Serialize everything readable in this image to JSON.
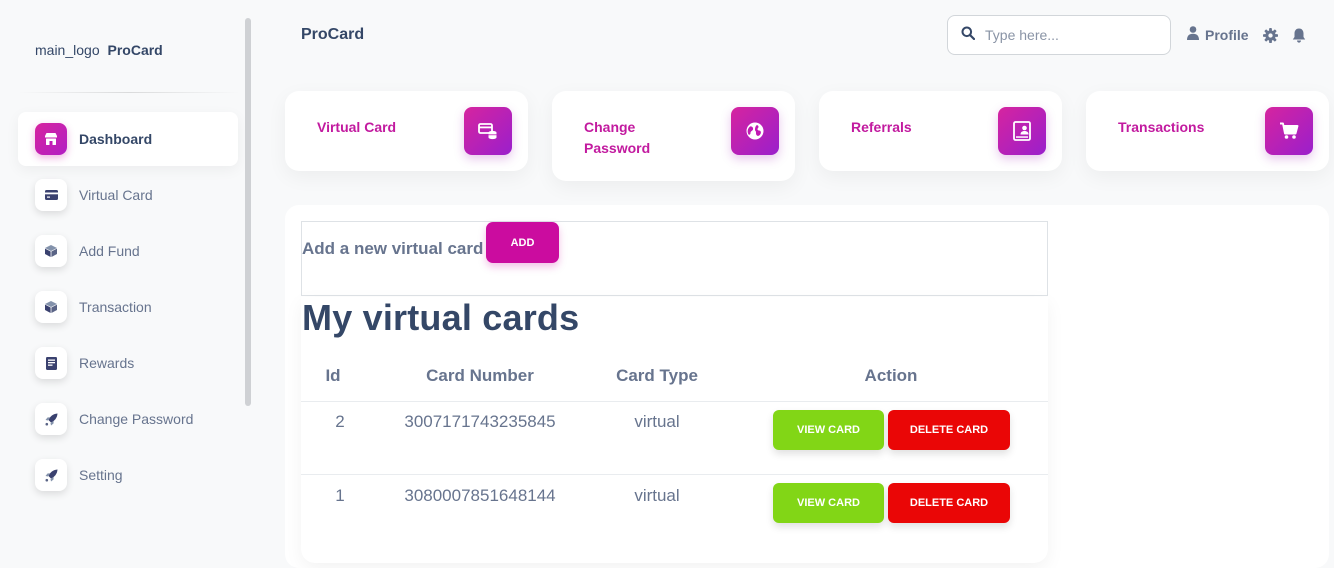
{
  "sidebar": {
    "logo_alt": "main_logo",
    "brand_name": "ProCard",
    "items": [
      {
        "label": "Dashboard",
        "icon": "shop-icon",
        "active": true
      },
      {
        "label": "Virtual Card",
        "icon": "credit-card-icon"
      },
      {
        "label": "Add Fund",
        "icon": "box-icon"
      },
      {
        "label": "Transaction",
        "icon": "box-icon"
      },
      {
        "label": "Rewards",
        "icon": "document-icon"
      },
      {
        "label": "Change Password",
        "icon": "rocket-icon"
      },
      {
        "label": "Setting",
        "icon": "rocket-icon"
      }
    ]
  },
  "header": {
    "title": "ProCard",
    "search_placeholder": "Type here...",
    "profile_label": "Profile"
  },
  "stat_cards": [
    {
      "label": "Virtual Card",
      "icon": "credit-card-icon"
    },
    {
      "label": "Change Password",
      "icon": "globe-icon"
    },
    {
      "label": "Referrals",
      "icon": "badge-icon"
    },
    {
      "label": "Transactions",
      "icon": "cart-icon"
    }
  ],
  "add_card": {
    "label": "Add a new virtual card",
    "button": "ADD"
  },
  "cards_table": {
    "title": "My virtual cards",
    "headers": [
      "Id",
      "Card Number",
      "Card Type",
      "Action"
    ],
    "rows": [
      {
        "id": "2",
        "number": "3007171743235845",
        "type": "virtual"
      },
      {
        "id": "1",
        "number": "3080007851648144",
        "type": "virtual"
      }
    ],
    "view_label": "VIEW CARD",
    "delete_label": "DELETE CARD"
  },
  "colors": {
    "accent": "#cb0c9f",
    "success": "#82d616",
    "danger": "#ea0606",
    "text": "#344767",
    "muted": "#67748e"
  }
}
